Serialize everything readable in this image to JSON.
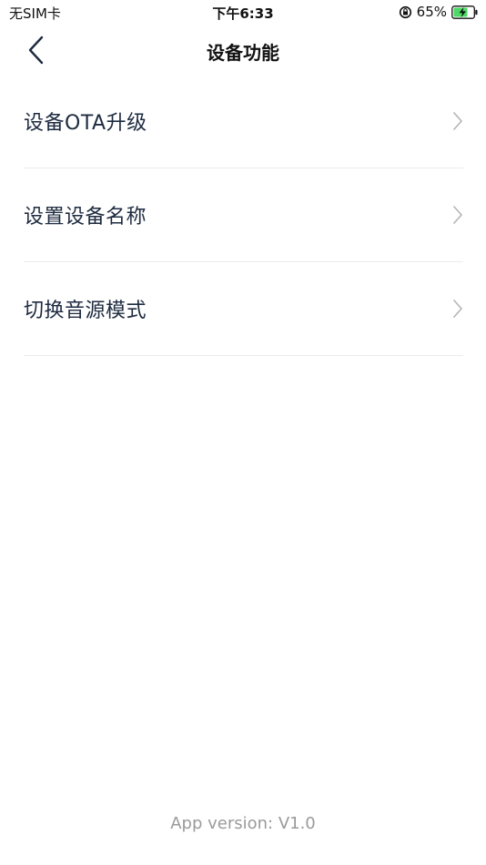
{
  "status_bar": {
    "carrier": "无SIM卡",
    "time": "下午6:33",
    "battery_percent": "65%",
    "icons": [
      "orientation-lock-icon",
      "battery-charging-icon"
    ]
  },
  "nav": {
    "title": "设备功能",
    "back_icon": "chevron-left-icon"
  },
  "menu": {
    "items": [
      {
        "label": "设备OTA升级",
        "icon": "chevron-right-icon"
      },
      {
        "label": "设置设备名称",
        "icon": "chevron-right-icon"
      },
      {
        "label": "切换音源模式",
        "icon": "chevron-right-icon"
      }
    ]
  },
  "footer": {
    "version_text": "App version: V1.0"
  },
  "colors": {
    "accent_green": "#4cd964",
    "label_text": "#1e2b40",
    "divider": "#ececec",
    "chevron": "#b5b5b5",
    "footer_text": "#9a9a9a"
  }
}
